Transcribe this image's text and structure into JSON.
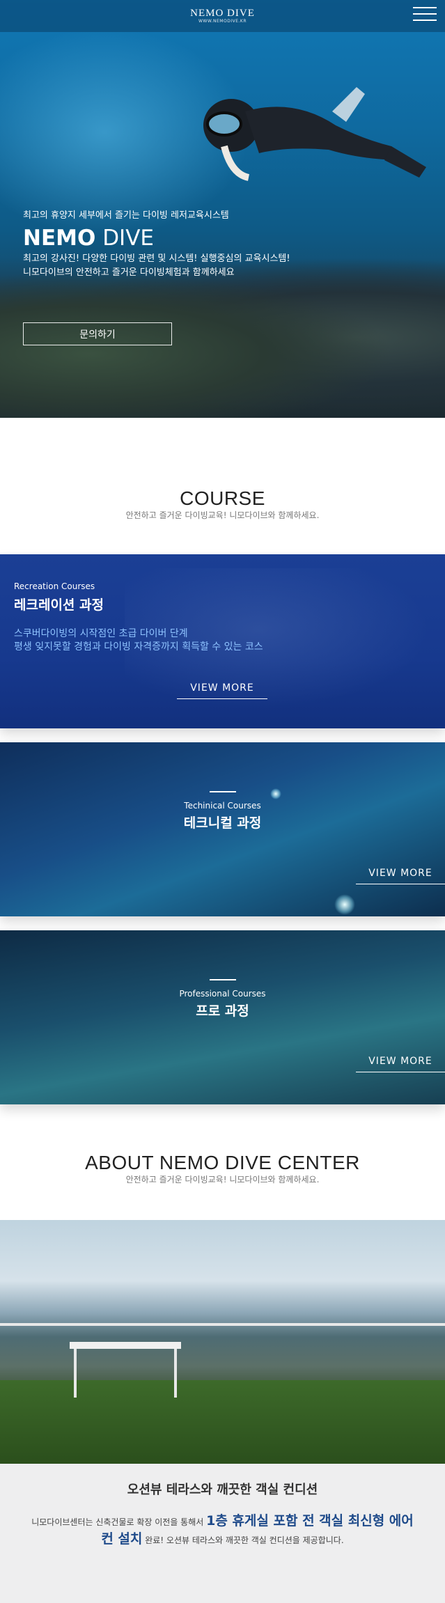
{
  "header": {
    "logo_main": "NEMO DIVE",
    "logo_sub": "WWW.NEMODIVE.KR"
  },
  "hero": {
    "kicker": "최고의 휴양지 세부에서 즐기는 다이빙 레저교육시스템",
    "title_bold": "NEMO",
    "title_light": "DIVE",
    "desc_line1": "최고의 강사진! 다양한 다이빙 관련 및 시스템! 실행중심의 교육시스템!",
    "desc_line2": "니모다이브의 안전하고 즐거운 다이빙체험과 함께하세요",
    "button": "문의하기"
  },
  "course_section": {
    "title": "COURSE",
    "subtitle": "안전하고 즐거운 다이빙교육! 니모다이브와 함께하세요."
  },
  "courses": [
    {
      "en": "Recreation Courses",
      "ko": "레크레이션 과정",
      "desc_line1": "스쿠버다이빙의 시작점인 초급 다이버 단계",
      "desc_line2": "평생 잊지못할 경험과 다이빙 자격증까지 획득할 수 있는 코스",
      "more": "VIEW MORE"
    },
    {
      "en": "Techinical Courses",
      "ko": "테크니컬 과정",
      "more": "VIEW MORE"
    },
    {
      "en": "Professional Courses",
      "ko": "프로 과정",
      "more": "VIEW MORE"
    }
  ],
  "about_section": {
    "title": "ABOUT NEMO DIVE CENTER",
    "subtitle": "안전하고 즐거운 다이빙교육! 니모다이브와 함께하세요.",
    "info_title": "오션뷰 테라스와 깨끗한 객실 컨디션",
    "info_pre": "니모다이브센터는 신축건물로 확장 이전을 통해서",
    "info_highlight": "1층 휴게실 포함 전 객실 최신형 에어컨 설치",
    "info_post": "완료! 오션뷰 테라스와 깨끗한 객실 컨디션을 제공합니다."
  },
  "colors": {
    "recreation_bg": "#1b3f95",
    "highlight_text": "#1e4a8a",
    "rec_desc": "#8ec3ff"
  },
  "icons": {
    "menu": "hamburger-menu-icon"
  }
}
